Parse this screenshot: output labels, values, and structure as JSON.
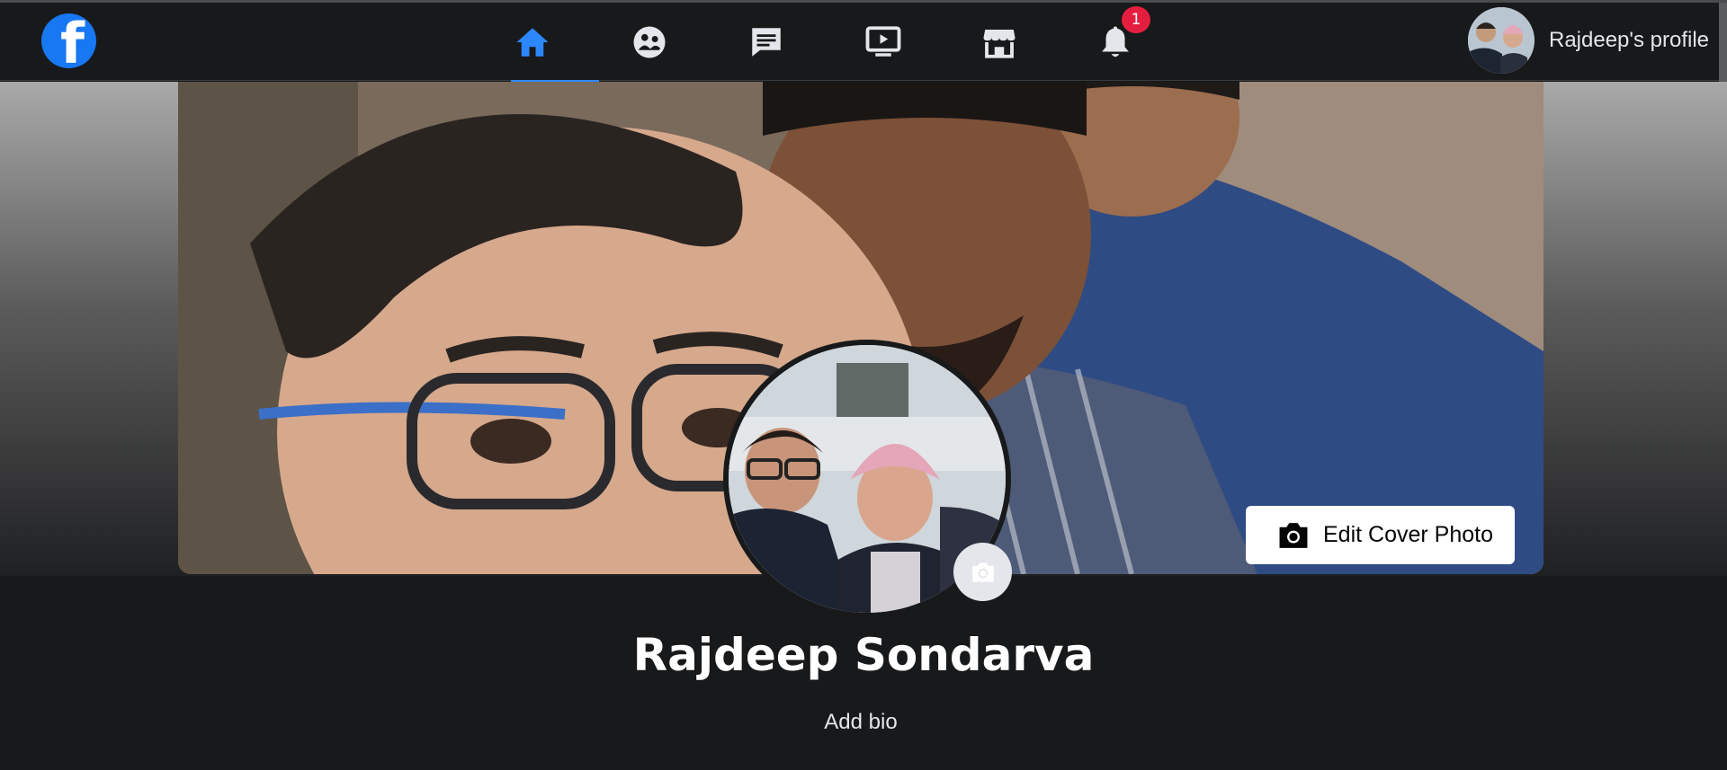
{
  "topbar": {
    "logo_letter": "f",
    "nav": [
      {
        "icon": "home-icon",
        "active": true
      },
      {
        "icon": "groups-icon",
        "active": false
      },
      {
        "icon": "messages-icon",
        "active": false
      },
      {
        "icon": "watch-icon",
        "active": false
      },
      {
        "icon": "marketplace-icon",
        "active": false
      },
      {
        "icon": "bell-icon",
        "active": false
      }
    ],
    "notification_count": "1",
    "profile_label": "Rajdeep's profile"
  },
  "cover": {
    "edit_label": "Edit Cover Photo"
  },
  "profile": {
    "name": "Rajdeep Sondarva",
    "bio_link": "Add bio"
  },
  "colors": {
    "accent": "#2d88ff",
    "logo": "#1877f2",
    "badge": "#e41e3f",
    "background": "#18191a"
  }
}
